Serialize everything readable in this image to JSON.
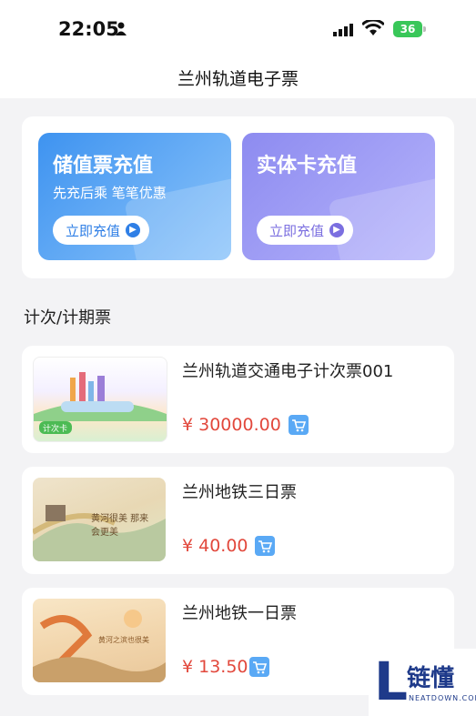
{
  "status": {
    "time": "22:05",
    "battery": "36"
  },
  "header": {
    "title": "兰州轨道电子票"
  },
  "recharge": [
    {
      "title": "储值票充值",
      "subtitle": "先充后乘 笔笔优惠",
      "button": "立即充值"
    },
    {
      "title": "实体卡充值",
      "subtitle": "",
      "button": "立即充值"
    }
  ],
  "section": {
    "title": "计次/计期票"
  },
  "tickets": [
    {
      "name": "兰州轨道交通电子计次票001",
      "price": "¥ 30000.00",
      "thumb_label": "计次卡"
    },
    {
      "name": "兰州地铁三日票",
      "price": "¥ 40.00",
      "thumb_label": "黄河很美 那来会更美"
    },
    {
      "name": "兰州地铁一日票",
      "price": "¥ 13.50",
      "thumb_label": "黄河之滨也很美"
    }
  ],
  "watermark": {
    "brand": "链懂",
    "site": "NEATDOWN.COM"
  },
  "icons": {
    "cart": "shopping-cart-icon",
    "arrow": "chevron-right-circle-icon"
  }
}
